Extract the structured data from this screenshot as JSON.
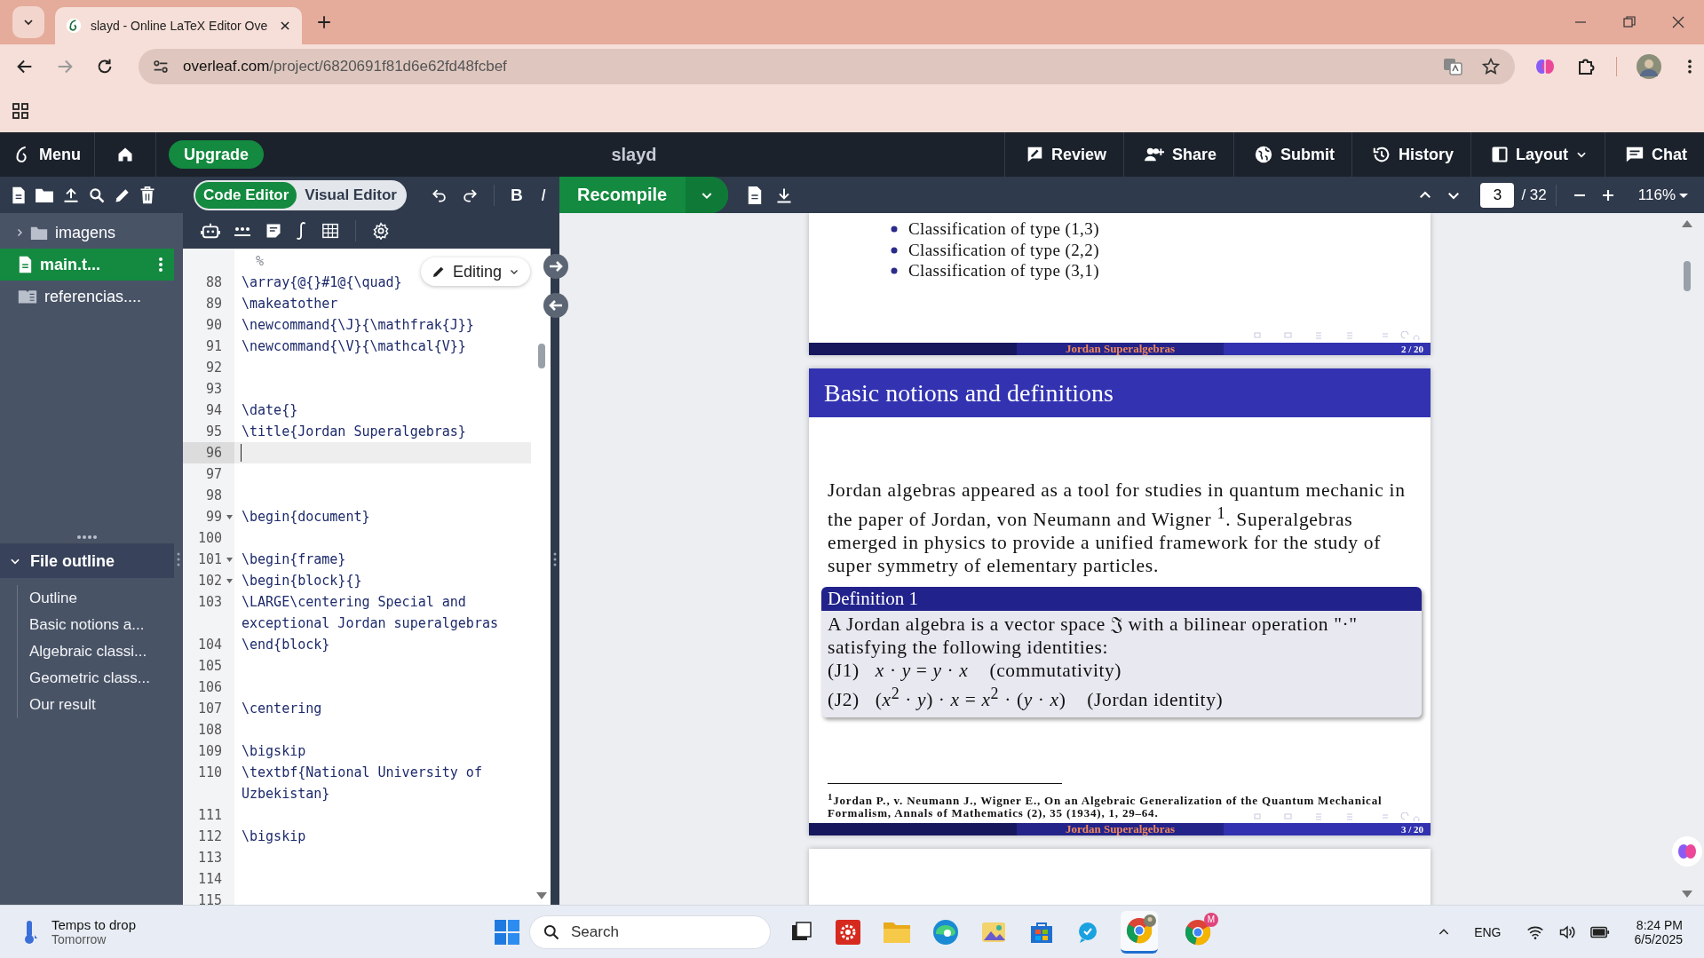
{
  "browser": {
    "tab_title": "slayd - Online LaTeX Editor Ove",
    "url_host": "overleaf.com",
    "url_path": "/project/6820691f81d6e62fd48fcbef"
  },
  "header": {
    "menu": "Menu",
    "upgrade": "Upgrade",
    "project_title": "slayd",
    "actions": [
      {
        "label": "Review",
        "kind": "review"
      },
      {
        "label": "Share",
        "kind": "share"
      },
      {
        "label": "Submit",
        "kind": "submit"
      },
      {
        "label": "History",
        "kind": "history"
      },
      {
        "label": "Layout",
        "kind": "layout"
      },
      {
        "label": "Chat",
        "kind": "chat"
      }
    ]
  },
  "toolbar": {
    "editor_modes": [
      {
        "label": "Code Editor",
        "selected": true
      },
      {
        "label": "Visual Editor",
        "selected": false
      }
    ],
    "format_buttons": [
      {
        "label": "B",
        "kind": "bold"
      },
      {
        "label": "I",
        "kind": "italic"
      }
    ],
    "recompile": "Recompile",
    "page": "3",
    "page_total": "/ 32",
    "zoom": "116%"
  },
  "file_tree": [
    {
      "name": "imagens",
      "kind": "folder",
      "selected": false
    },
    {
      "name": "main.t...",
      "kind": "tex",
      "selected": true
    },
    {
      "name": "referencias....",
      "kind": "bib",
      "selected": false
    }
  ],
  "outline": {
    "title": "File outline",
    "expanded": true,
    "items": [
      "Outline",
      "Basic notions a...",
      "Algebraic classi...",
      "Geometric class...",
      "Our result"
    ]
  },
  "editor": {
    "mode": "Editing",
    "lines": [
      {
        "rows": [
          "%"
        ],
        "kind": "comment",
        "active": false,
        "foldable": false
      },
      {
        "number": "88",
        "rows": [
          "\\array{@{}#1@{\\quad}"
        ],
        "kind": "code",
        "active": false,
        "foldable": false
      },
      {
        "number": "89",
        "rows": [
          "\\makeatother"
        ],
        "kind": "code",
        "active": false,
        "foldable": false
      },
      {
        "number": "90",
        "rows": [
          "\\newcommand{\\J}{\\mathfrak{J}}"
        ],
        "kind": "code",
        "active": false,
        "foldable": false
      },
      {
        "number": "91",
        "rows": [
          "\\newcommand{\\V}{\\mathcal{V}}"
        ],
        "kind": "code",
        "active": false,
        "foldable": false
      },
      {
        "number": "92",
        "active": false,
        "foldable": false
      },
      {
        "number": "93",
        "active": false,
        "foldable": false
      },
      {
        "number": "94",
        "rows": [
          "\\date{}"
        ],
        "kind": "code",
        "active": false,
        "foldable": false
      },
      {
        "number": "95",
        "rows": [
          "\\title{Jordan Superalgebras}"
        ],
        "kind": "code",
        "active": false,
        "foldable": false
      },
      {
        "number": "96",
        "active": true,
        "foldable": false
      },
      {
        "number": "97",
        "active": false,
        "foldable": false
      },
      {
        "number": "98",
        "active": false,
        "foldable": false
      },
      {
        "number": "99",
        "rows": [
          "\\begin{document}"
        ],
        "kind": "code",
        "active": false,
        "foldable": true
      },
      {
        "number": "100",
        "active": false,
        "foldable": false
      },
      {
        "number": "101",
        "rows": [
          "\\begin{frame}"
        ],
        "kind": "code",
        "active": false,
        "foldable": true
      },
      {
        "number": "102",
        "rows": [
          "\\begin{block}{}"
        ],
        "kind": "code",
        "active": false,
        "foldable": true
      },
      {
        "number": "103",
        "rows": [
          "\\LARGE\\centering Special and",
          "exceptional Jordan superalgebras"
        ],
        "kind": "code",
        "active": false,
        "foldable": false
      },
      {
        "number": "104",
        "rows": [
          "\\end{block}"
        ],
        "kind": "code",
        "active": false,
        "foldable": false
      },
      {
        "number": "105",
        "active": false,
        "foldable": false
      },
      {
        "number": "106",
        "active": false,
        "foldable": false
      },
      {
        "number": "107",
        "rows": [
          "\\centering"
        ],
        "kind": "code",
        "active": false,
        "foldable": false
      },
      {
        "number": "108",
        "active": false,
        "foldable": false
      },
      {
        "number": "109",
        "rows": [
          "\\bigskip"
        ],
        "kind": "code",
        "active": false,
        "foldable": false
      },
      {
        "number": "110",
        "rows": [
          "\\textbf{National University of",
          "Uzbekistan}"
        ],
        "kind": "code",
        "active": false,
        "foldable": false
      },
      {
        "number": "111",
        "active": false,
        "foldable": false
      },
      {
        "number": "112",
        "rows": [
          "\\bigskip"
        ],
        "kind": "code",
        "active": false,
        "foldable": false
      },
      {
        "number": "113",
        "active": false,
        "foldable": false
      },
      {
        "number": "114",
        "active": false,
        "foldable": false
      },
      {
        "number": "115",
        "active": false,
        "foldable": false
      }
    ]
  },
  "pdf": {
    "pages": [
      {
        "kind": "partial",
        "bullets": [
          "Classification of type (1,3)",
          "Classification of type (2,2)",
          "Classification of type (3,1)"
        ],
        "footer_title": "Jordan Superalgebras",
        "page_label": "2 / 20"
      },
      {
        "kind": "full",
        "frame_title": "Basic notions and definitions",
        "paragraph_lines": [
          "Jordan algebras appeared as a tool for studies in quantum mechanic in",
          "the paper of Jordan, von Neumann and Wigner $^{1}$. Superalgebras",
          "emerged in physics to provide a unified framework for the study of",
          "super symmetry of elementary particles."
        ],
        "block": {
          "title": "Definition 1",
          "lines": [
            "A Jordan algebra is a vector space 𝔍 with a bilinear operation \"·\"",
            "satisfying the following identities:",
            "(J1)   *x* · *y* = *y* · *x*    (commutativity)",
            "(J2)   (*x*$^{2}$ · *y*) · *x* = *x*$^{2}$ · (*y* · *x*)    (Jordan identity)"
          ]
        },
        "footnote_lines": [
          "$^{1}$Jordan P., v. Neumann J., Wigner E., On an Algebraic Generalization of the Quantum Mechanical",
          "Formalism, Annals of Mathematics (2), 35 (1934), 1, 29–64."
        ],
        "footer_title": "Jordan Superalgebras",
        "page_label": "3 / 20"
      },
      {
        "kind": "blank"
      }
    ]
  },
  "taskbar": {
    "weather_title": "Temps to drop",
    "weather_sub": "Tomorrow",
    "search": "Search",
    "badge": "M",
    "language": "ENG",
    "time": "8:24 PM",
    "date": "6/5/2025"
  }
}
